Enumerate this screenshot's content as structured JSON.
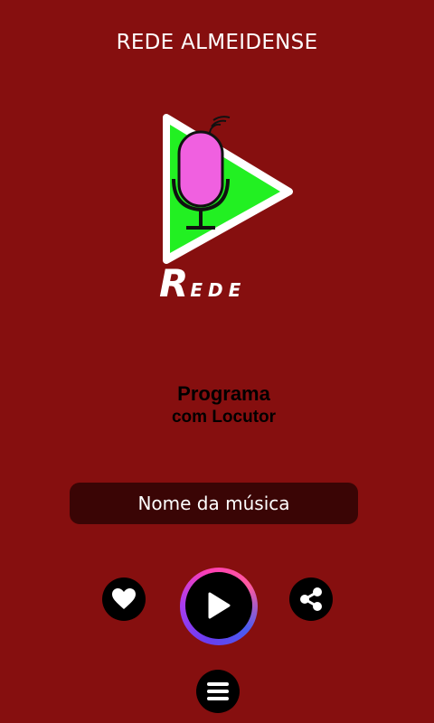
{
  "header": {
    "title": "REDE ALMEIDENSE"
  },
  "logo": {
    "text": "REDE",
    "colors": {
      "triangle": "#22f022",
      "microphone": "#f060e0"
    }
  },
  "program": {
    "title": "Programa",
    "subtitle": "com Locutor"
  },
  "now_playing": {
    "song": "Nome da música"
  },
  "controls": {
    "like_icon": "heart-icon",
    "play_icon": "play-icon",
    "share_icon": "share-icon",
    "menu_icon": "hamburger-menu-icon"
  },
  "theme": {
    "background": "#860f0f",
    "song_box": "#3a0505"
  }
}
